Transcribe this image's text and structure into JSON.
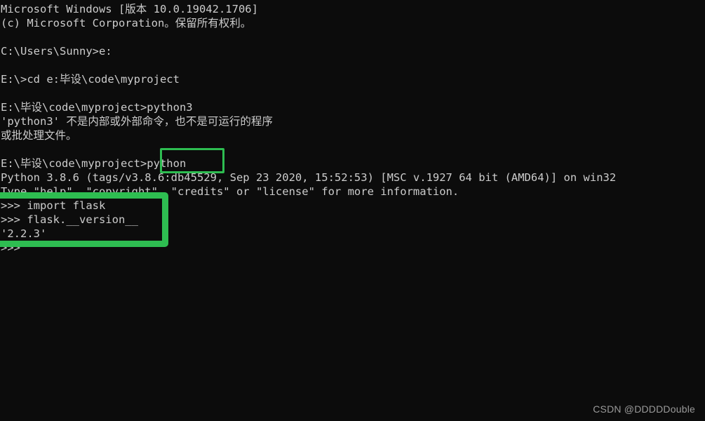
{
  "terminal": {
    "background_color": "#0c0c0c",
    "text_color": "#cccccc",
    "lines": [
      "Microsoft Windows [版本 10.0.19042.1706]",
      "(c) Microsoft Corporation。保留所有权利。",
      "",
      "C:\\Users\\Sunny>e:",
      "",
      "E:\\>cd e:毕设\\code\\myproject",
      "",
      "E:\\毕设\\code\\myproject>python3",
      "'python3' 不是内部或外部命令，也不是可运行的程序",
      "或批处理文件。",
      "",
      "E:\\毕设\\code\\myproject>python",
      "Python 3.8.6 (tags/v3.8.6:db45529, Sep 23 2020, 15:52:53) [MSC v.1927 64 bit (AMD64)] on win32",
      "Type \"help\", \"copyright\", \"credits\" or \"license\" for more information.",
      ">>> import flask",
      ">>> flask.__version__",
      "'2.2.3'",
      ">>>"
    ]
  },
  "annotations": {
    "color": "#2ebd51",
    "python_command_highlight": "python",
    "flask_version_highlight": ">>> import flask / >>> flask.__version__ / '2.2.3'"
  },
  "watermark": {
    "text": "CSDN @DDDDDouble"
  }
}
